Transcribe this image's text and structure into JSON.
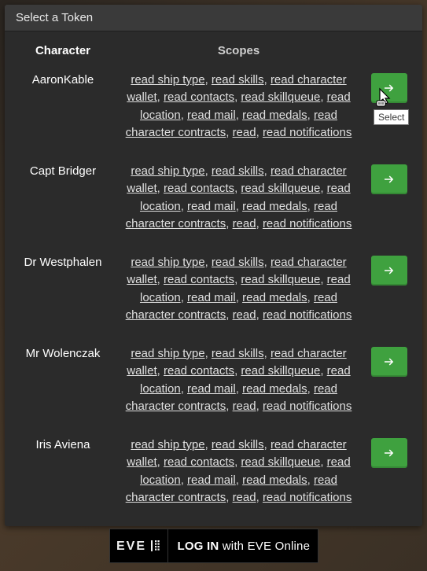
{
  "modal": {
    "title": "Select a Token",
    "columns": {
      "character": "Character",
      "scopes": "Scopes"
    }
  },
  "tooltip": "Select",
  "scopes": [
    "read ship type",
    "read skills",
    "read character wallet",
    "read contacts",
    "read skillqueue",
    "read location",
    "read mail",
    "read medals",
    "read character contracts",
    "read",
    "read notifications"
  ],
  "rows": [
    {
      "character": "AaronKable"
    },
    {
      "character": "Capt Bridger"
    },
    {
      "character": "Dr Westphalen"
    },
    {
      "character": "Mr Wolenczak"
    },
    {
      "character": "Iris Aviena"
    }
  ],
  "login": {
    "brand": "EVE",
    "prefix": "LOG IN",
    "suffix": "with EVE Online"
  }
}
